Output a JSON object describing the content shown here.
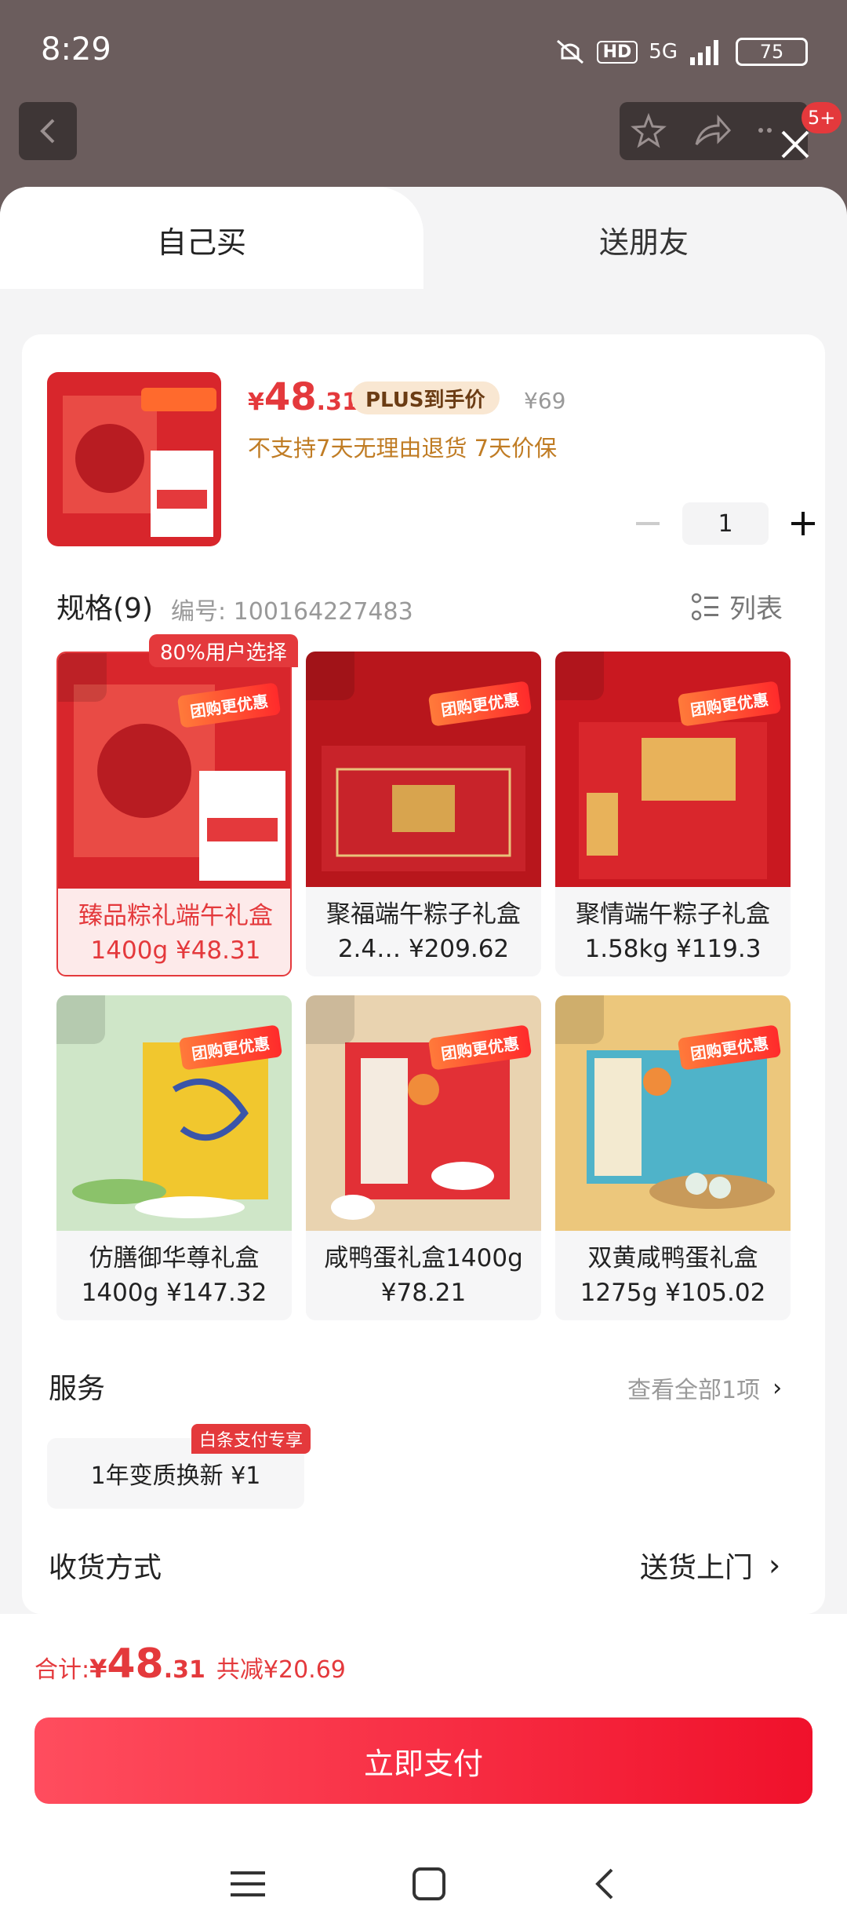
{
  "status_bar": {
    "time": "8:29",
    "hd": "HD",
    "network": "5G",
    "battery": "75"
  },
  "top_bar": {
    "badge": "5+"
  },
  "tabs": {
    "self": "自己买",
    "friend": "送朋友"
  },
  "product": {
    "price_symbol": "¥",
    "price_int": "48",
    "price_dec": ".31",
    "plus_tag": "PLUS到手价",
    "original_price": "¥69",
    "notice": "不支持7天无理由退货 7天价保",
    "quantity": "1",
    "thumb_promo": "团购更优惠"
  },
  "spec": {
    "title": "规格(9)",
    "code": "编号: 100164227483",
    "list_label": "列表",
    "selected_badge": "80%用户选择",
    "items": [
      {
        "line1": "臻品粽礼端午礼盒",
        "line2": "1400g ¥48.31",
        "promo": "团购更优惠"
      },
      {
        "line1": "聚福端午粽子礼盒",
        "line2": "2.4… ¥209.62",
        "promo": "团购更优惠"
      },
      {
        "line1": "聚情端午粽子礼盒",
        "line2": "1.58kg ¥119.3",
        "promo": "团购更优惠"
      },
      {
        "line1": "仿膳御华尊礼盒",
        "line2": "1400g ¥147.32",
        "promo": "团购更优惠"
      },
      {
        "line1": "咸鸭蛋礼盒1400g",
        "line2": "¥78.21",
        "promo": "团购更优惠"
      },
      {
        "line1": "双黄咸鸭蛋礼盒",
        "line2": "1275g ¥105.02",
        "promo": "团购更优惠"
      }
    ]
  },
  "service": {
    "title": "服务",
    "more": "查看全部1项",
    "chip": "1年变质换新 ¥1",
    "chip_badge": "白条支付专享"
  },
  "shipping": {
    "title": "收货方式",
    "value": "送货上门"
  },
  "footer": {
    "total_label": "合计: ",
    "total_symbol": "¥",
    "total_int": "48",
    "total_dec": ".31",
    "discount": "共减¥20.69",
    "pay_label": "立即支付"
  },
  "colors": {
    "accent": "#e4393c",
    "gold_text": "#c07c24",
    "plus_bg": "#f9e7d2"
  }
}
